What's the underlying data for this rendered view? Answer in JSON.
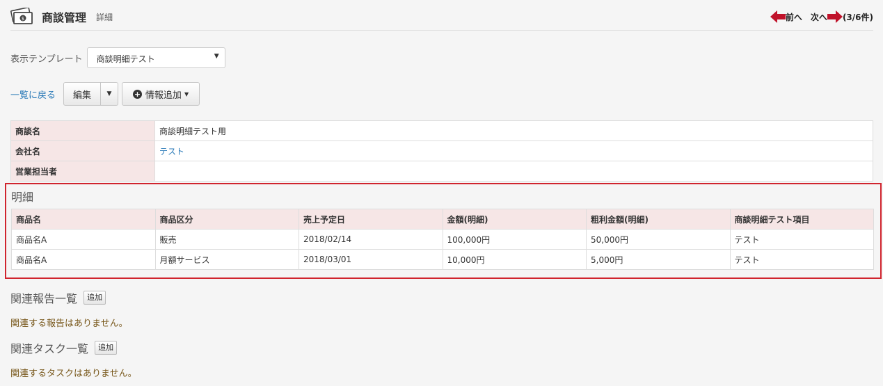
{
  "header": {
    "title": "商談管理",
    "subtitle": "詳細",
    "prev_label": "前へ",
    "next_label": "次へ",
    "count": "(3/6件)"
  },
  "template": {
    "label": "表示テンプレート",
    "selected": "商談明細テスト"
  },
  "actions": {
    "back": "一覧に戻る",
    "edit": "編集",
    "add_info": "情報追加"
  },
  "info": {
    "rows": [
      {
        "label": "商談名",
        "value": "商談明細テスト用"
      },
      {
        "label": "会社名",
        "value": "テスト"
      },
      {
        "label": "営業担当者",
        "value": ""
      }
    ]
  },
  "detail": {
    "title": "明細",
    "headers": [
      "商品名",
      "商品区分",
      "売上予定日",
      "金額(明細)",
      "粗利金額(明細)",
      "商談明細テスト項目"
    ],
    "rows": [
      [
        "商品名A",
        "販売",
        "2018/02/14",
        "100,000円",
        "50,000円",
        "テスト"
      ],
      [
        "商品名A",
        "月額サービス",
        "2018/03/01",
        "10,000円",
        "5,000円",
        "テスト"
      ]
    ]
  },
  "related_reports": {
    "title": "関連報告一覧",
    "add": "追加",
    "empty": "関連する報告はありません。"
  },
  "related_tasks": {
    "title": "関連タスク一覧",
    "add": "追加",
    "empty": "関連するタスクはありません。"
  },
  "colors": {
    "accent_red": "#d0242e",
    "link_blue": "#2a7ab8",
    "label_bg": "#f6e6e6",
    "arrow_red": "#c0122a"
  }
}
